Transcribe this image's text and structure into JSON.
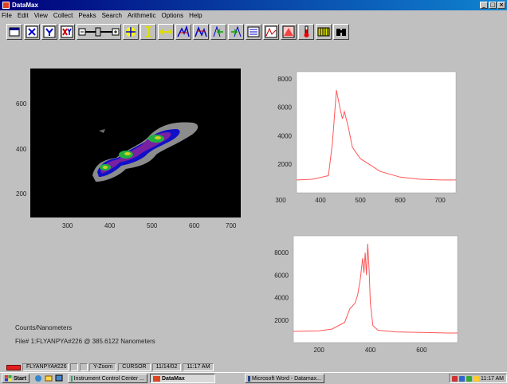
{
  "window": {
    "title": "DataMax"
  },
  "menu": [
    "File",
    "Edit",
    "View",
    "Collect",
    "Peaks",
    "Search",
    "Arithmetic",
    "Options",
    "Help"
  ],
  "contour_axes": {
    "x_ticks": [
      "300",
      "400",
      "500",
      "600",
      "700"
    ],
    "y_ticks": [
      "600",
      "400",
      "200"
    ]
  },
  "chart_data": [
    {
      "type": "line",
      "x": [
        340,
        380,
        420,
        430,
        440,
        450,
        455,
        460,
        470,
        480,
        500,
        550,
        600,
        650,
        700,
        740
      ],
      "y": [
        900,
        950,
        1200,
        3500,
        7200,
        5800,
        5200,
        5700,
        4600,
        3200,
        2400,
        1500,
        1100,
        950,
        900,
        900
      ],
      "xlim": [
        340,
        740
      ],
      "ylim": [
        0,
        8500
      ],
      "x_ticks": [
        300,
        400,
        500,
        600,
        700
      ],
      "y_ticks": [
        2000,
        4000,
        6000,
        8000
      ],
      "color": "#ff5555"
    },
    {
      "type": "line",
      "x": [
        100,
        200,
        250,
        300,
        320,
        340,
        350,
        360,
        370,
        375,
        380,
        385,
        390,
        395,
        400,
        410,
        430,
        500,
        600,
        700,
        740
      ],
      "y": [
        1000,
        1050,
        1200,
        1800,
        3000,
        3500,
        4200,
        5500,
        7500,
        6200,
        8000,
        6000,
        8800,
        6500,
        3500,
        1500,
        1100,
        950,
        900,
        850,
        850
      ],
      "xlim": [
        100,
        740
      ],
      "ylim": [
        0,
        9500
      ],
      "x_ticks": [
        200,
        400,
        600
      ],
      "y_ticks": [
        2000,
        4000,
        6000,
        8000
      ],
      "color": "#ff5555"
    }
  ],
  "info": {
    "units": "Counts/Nanometers",
    "file_info": "File# 1:FLYANPYA#226 @ 385.6122 Nanometers"
  },
  "status": {
    "file": "FLYANPYA#226",
    "mode": "Y-Zoom",
    "cursor": "CURSOR",
    "date": "11/14/02",
    "time": "11:17 AM"
  },
  "taskbar": {
    "start": "Start",
    "tasks": [
      "Instrument Control Center ...",
      "DataMax",
      "Microsoft Word - Datamax..."
    ],
    "clock": "11:17 AM"
  }
}
